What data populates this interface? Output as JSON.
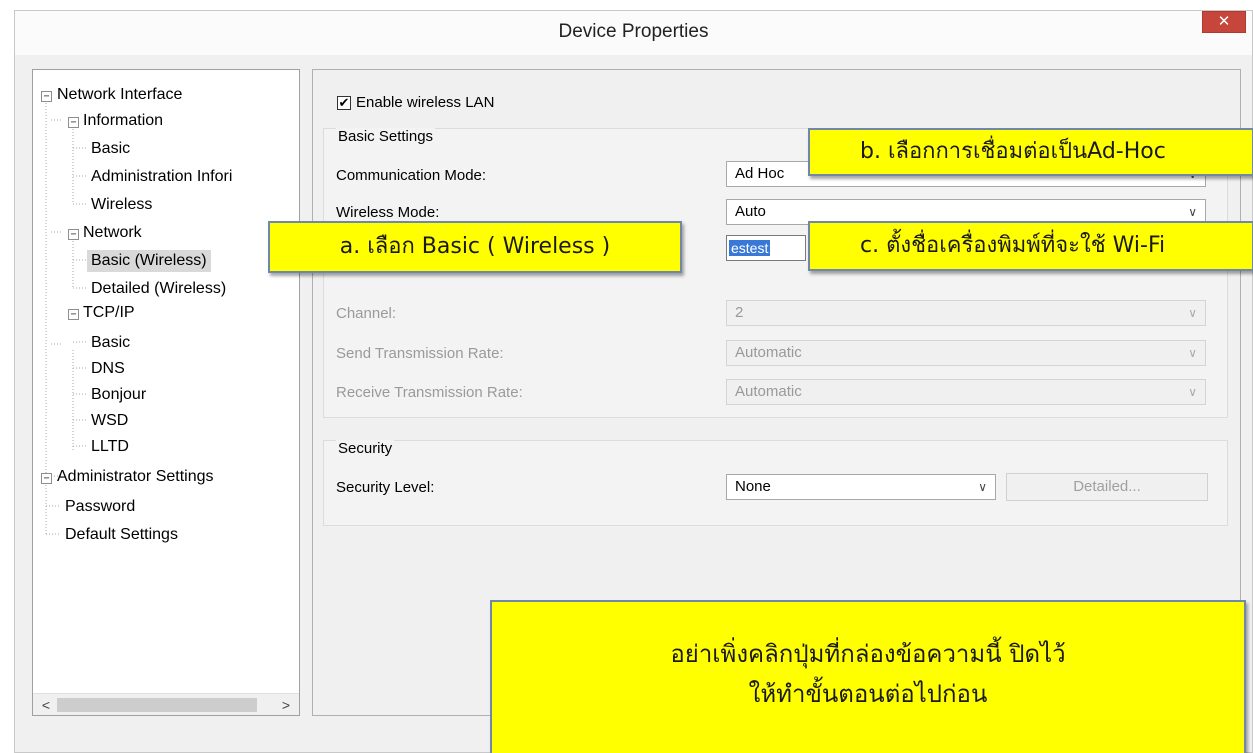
{
  "window": {
    "title": "Device Properties",
    "close_glyph": "✕"
  },
  "tree": {
    "items": [
      {
        "label": "Network Interface",
        "toggle": "−"
      },
      {
        "label": "Information",
        "toggle": "−"
      },
      {
        "label": "Basic"
      },
      {
        "label": "Administration Infori"
      },
      {
        "label": "Wireless"
      },
      {
        "label": "Network",
        "toggle": "−"
      },
      {
        "label": "Basic (Wireless)",
        "selected": true
      },
      {
        "label": "Detailed (Wireless)"
      },
      {
        "label": "TCP/IP",
        "toggle": "−"
      },
      {
        "label": "Basic"
      },
      {
        "label": "DNS"
      },
      {
        "label": "Bonjour"
      },
      {
        "label": "WSD"
      },
      {
        "label": "LLTD"
      },
      {
        "label": "Administrator Settings",
        "toggle": "−"
      },
      {
        "label": "Password"
      },
      {
        "label": "Default Settings"
      }
    ],
    "scroll_left": "<",
    "scroll_right": ">"
  },
  "settings": {
    "enable_wireless": {
      "label": "Enable wireless LAN",
      "checked": true,
      "check_glyph": "✔"
    },
    "basic_group_title": "Basic Settings",
    "communication_mode": {
      "label": "Communication Mode:",
      "value": "Ad Hoc"
    },
    "wireless_mode": {
      "label": "Wireless Mode:",
      "value": "Auto"
    },
    "ssid": {
      "value": "estest"
    },
    "channel": {
      "label": "Channel:",
      "value": "2"
    },
    "send_rate": {
      "label": "Send Transmission Rate:",
      "value": "Automatic"
    },
    "receive_rate": {
      "label": "Receive Transmission Rate:",
      "value": "Automatic"
    },
    "security_group_title": "Security",
    "security_level": {
      "label": "Security Level:",
      "value": "None"
    },
    "detailed_button": "Detailed...",
    "chevron": "∨"
  },
  "callouts": {
    "a": "a. เลือก Basic ( Wireless )",
    "b": "b. เลือกการเชื่อมต่อเป็นAd-Hoc",
    "c": "c. ตั้งชื่อเครื่องพิมพ์ที่จะใช้  Wi-Fi",
    "warning_line1": "อย่าเพิ่งคลิกปุ่มที่กล่องข้อความนี้ ปิดไว้",
    "warning_line2": "ให้ทำขั้นตอนต่อไปก่อน"
  },
  "colors": {
    "callout_fill": "#ffff00",
    "close_button": "#c7463b",
    "selection_highlight": "#3a78d8"
  }
}
